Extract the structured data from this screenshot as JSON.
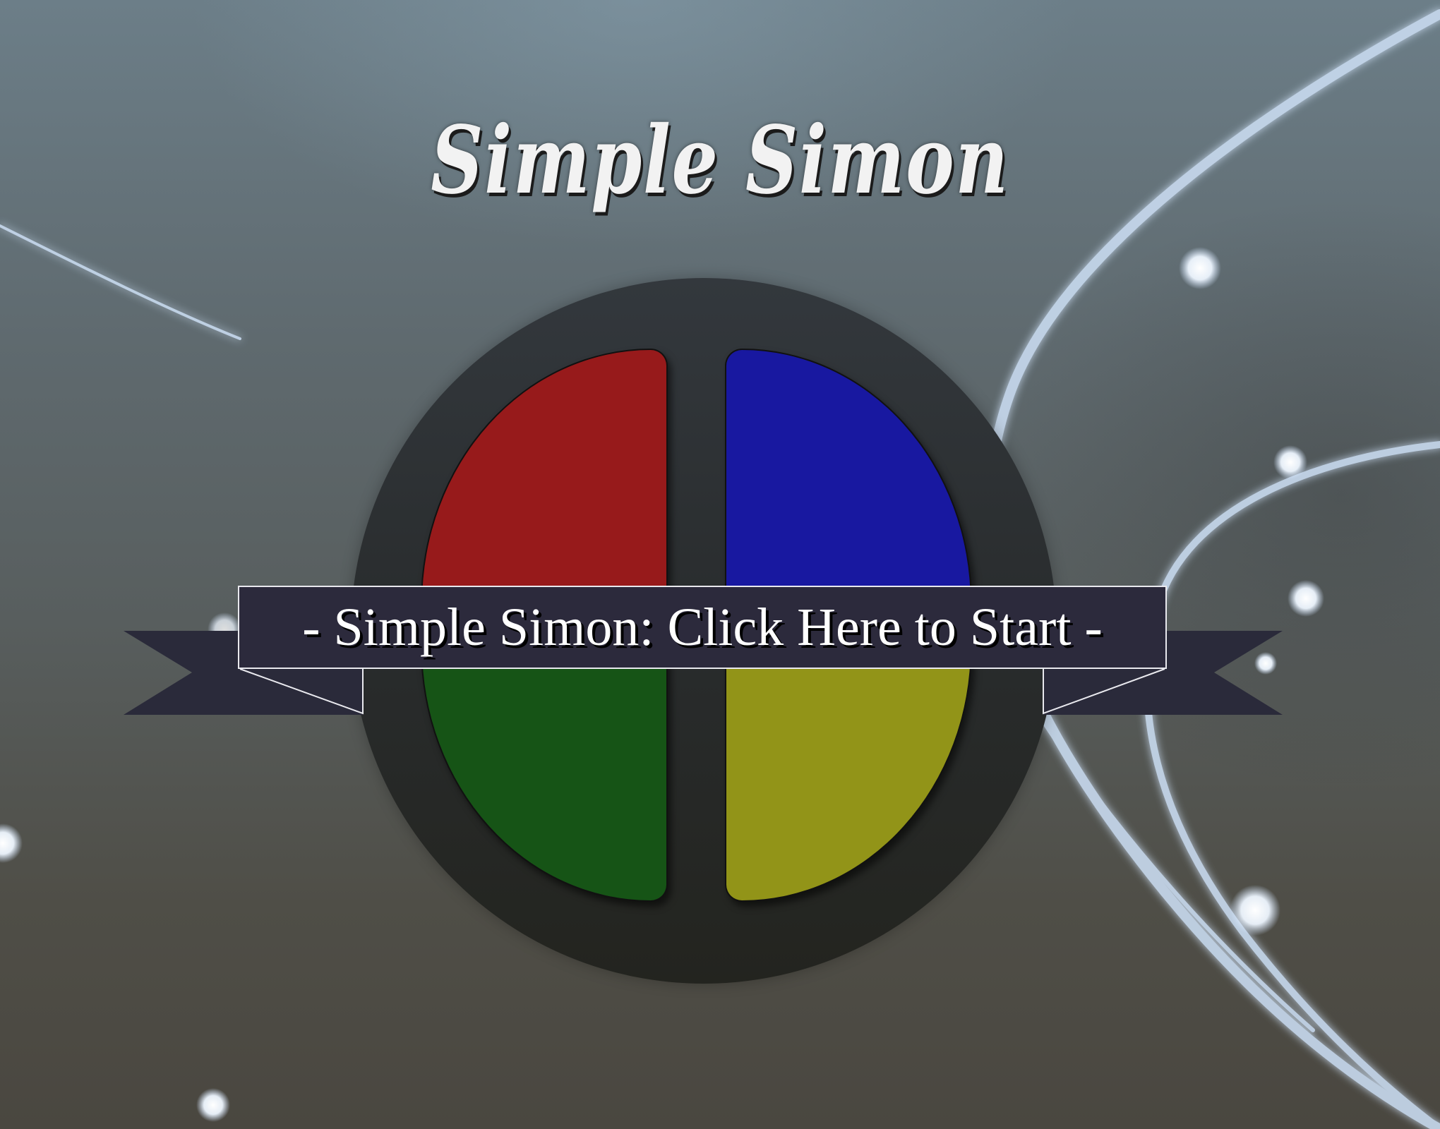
{
  "game": {
    "title": "Simple Simon",
    "start_banner": "- Simple Simon: Click Here to Start -"
  },
  "pads": [
    {
      "color_name": "red",
      "color": "#971a1b"
    },
    {
      "color_name": "blue",
      "color": "#1818a0"
    },
    {
      "color_name": "green",
      "color": "#165416"
    },
    {
      "color_name": "yellow",
      "color": "#929418"
    }
  ],
  "theme": {
    "board_color": "#2c2f31",
    "banner_color": "#2c2a3c",
    "ribbon_color": "#2a2a3a"
  }
}
